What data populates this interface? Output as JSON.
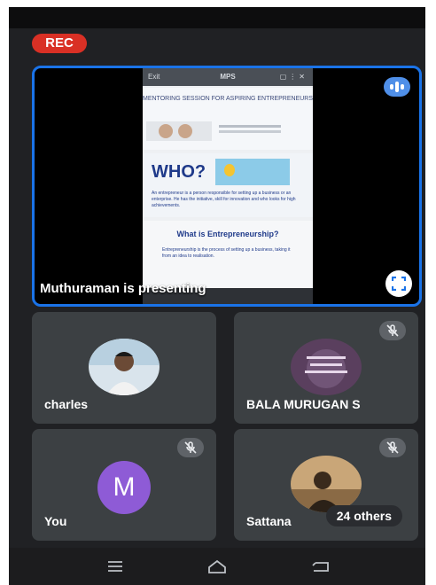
{
  "recording": {
    "label": "REC",
    "color": "#d93025"
  },
  "presentation": {
    "label": "Muthuraman is presenting",
    "accent": "#1a73e8",
    "shared_screen": {
      "top_bar": {
        "left": "Exit",
        "title": "MPS"
      },
      "slide1_title": "MENTORING SESSION FOR ASPIRING ENTREPRENEURS",
      "slide2_heading": "WHO?",
      "slide2_text": "An entrepreneur is a person responsible for setting up a business or an enterprise. He has the initiative, skill for innovation and who looks for high achievements.",
      "slide3_heading": "What is Entrepreneurship?",
      "slide3_text": "Entrepreneurship is the process of setting up a business, taking it from an idea to realisation."
    }
  },
  "participants": [
    {
      "name": "charles",
      "muted": false
    },
    {
      "name": "BALA MURUGAN S",
      "muted": true
    },
    {
      "name": "You",
      "initial": "M",
      "muted": true,
      "avatar_color": "#8e5bd6"
    },
    {
      "name": "Sattana",
      "muted": true
    }
  ],
  "others_badge": "24 others",
  "icons": {
    "pin": "audio-activity-icon",
    "fullscreen": "fullscreen-icon",
    "mute": "mic-off-icon",
    "nav": [
      "recent-apps-icon",
      "home-icon",
      "back-icon"
    ]
  }
}
